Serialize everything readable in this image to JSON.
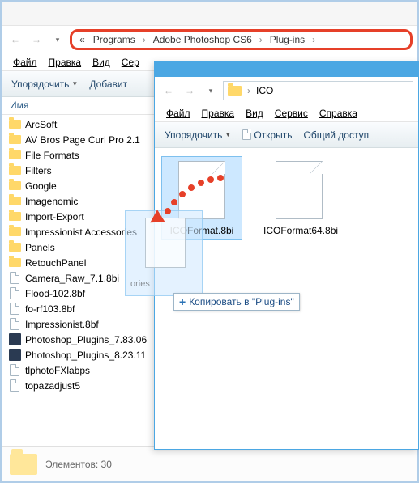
{
  "back": {
    "breadcrumb": {
      "prefix": "«",
      "p0": "Programs",
      "p1": "Adobe Photoshop CS6",
      "p2": "Plug-ins"
    },
    "menu": {
      "file": "Файл",
      "edit": "Правка",
      "view": "Вид",
      "service": "Сер"
    },
    "toolbar": {
      "organize": "Упорядочить",
      "add": "Добавит"
    },
    "col_name": "Имя",
    "items": [
      {
        "name": "ArcSoft",
        "type": "folder"
      },
      {
        "name": "AV Bros Page Curl Pro 2.1",
        "type": "folder"
      },
      {
        "name": "File Formats",
        "type": "folder"
      },
      {
        "name": "Filters",
        "type": "folder"
      },
      {
        "name": "Google",
        "type": "folder"
      },
      {
        "name": "Imagenomic",
        "type": "folder"
      },
      {
        "name": "Import-Export",
        "type": "folder"
      },
      {
        "name": "Impressionist Accessories",
        "type": "folder"
      },
      {
        "name": "Panels",
        "type": "folder"
      },
      {
        "name": "RetouchPanel",
        "type": "folder"
      },
      {
        "name": "Camera_Raw_7.1.8bi",
        "type": "file"
      },
      {
        "name": "Flood-102.8bf",
        "type": "file"
      },
      {
        "name": "fo-rf103.8bf",
        "type": "file"
      },
      {
        "name": "Impressionist.8bf",
        "type": "file"
      },
      {
        "name": "Photoshop_Plugins_7.83.06",
        "type": "app"
      },
      {
        "name": "Photoshop_Plugins_8.23.11",
        "type": "app"
      },
      {
        "name": "tlphotoFXlabps",
        "type": "file"
      },
      {
        "name": "topazadjust5",
        "type": "file"
      }
    ],
    "status": "Элементов: 30"
  },
  "front": {
    "title": "ICO",
    "menu": {
      "file": "Файл",
      "edit": "Правка",
      "view": "Вид",
      "service": "Сервис",
      "help": "Справка"
    },
    "toolbar": {
      "organize": "Упорядочить",
      "open": "Открыть",
      "share": "Общий доступ"
    },
    "files": [
      {
        "name": "ICOFormat.8bi",
        "selected": true
      },
      {
        "name": "ICOFormat64.8bi",
        "selected": false
      }
    ]
  },
  "drag": {
    "ghost_label": "ories"
  },
  "tooltip": {
    "text": "Копировать в \"Plug-ins\""
  }
}
